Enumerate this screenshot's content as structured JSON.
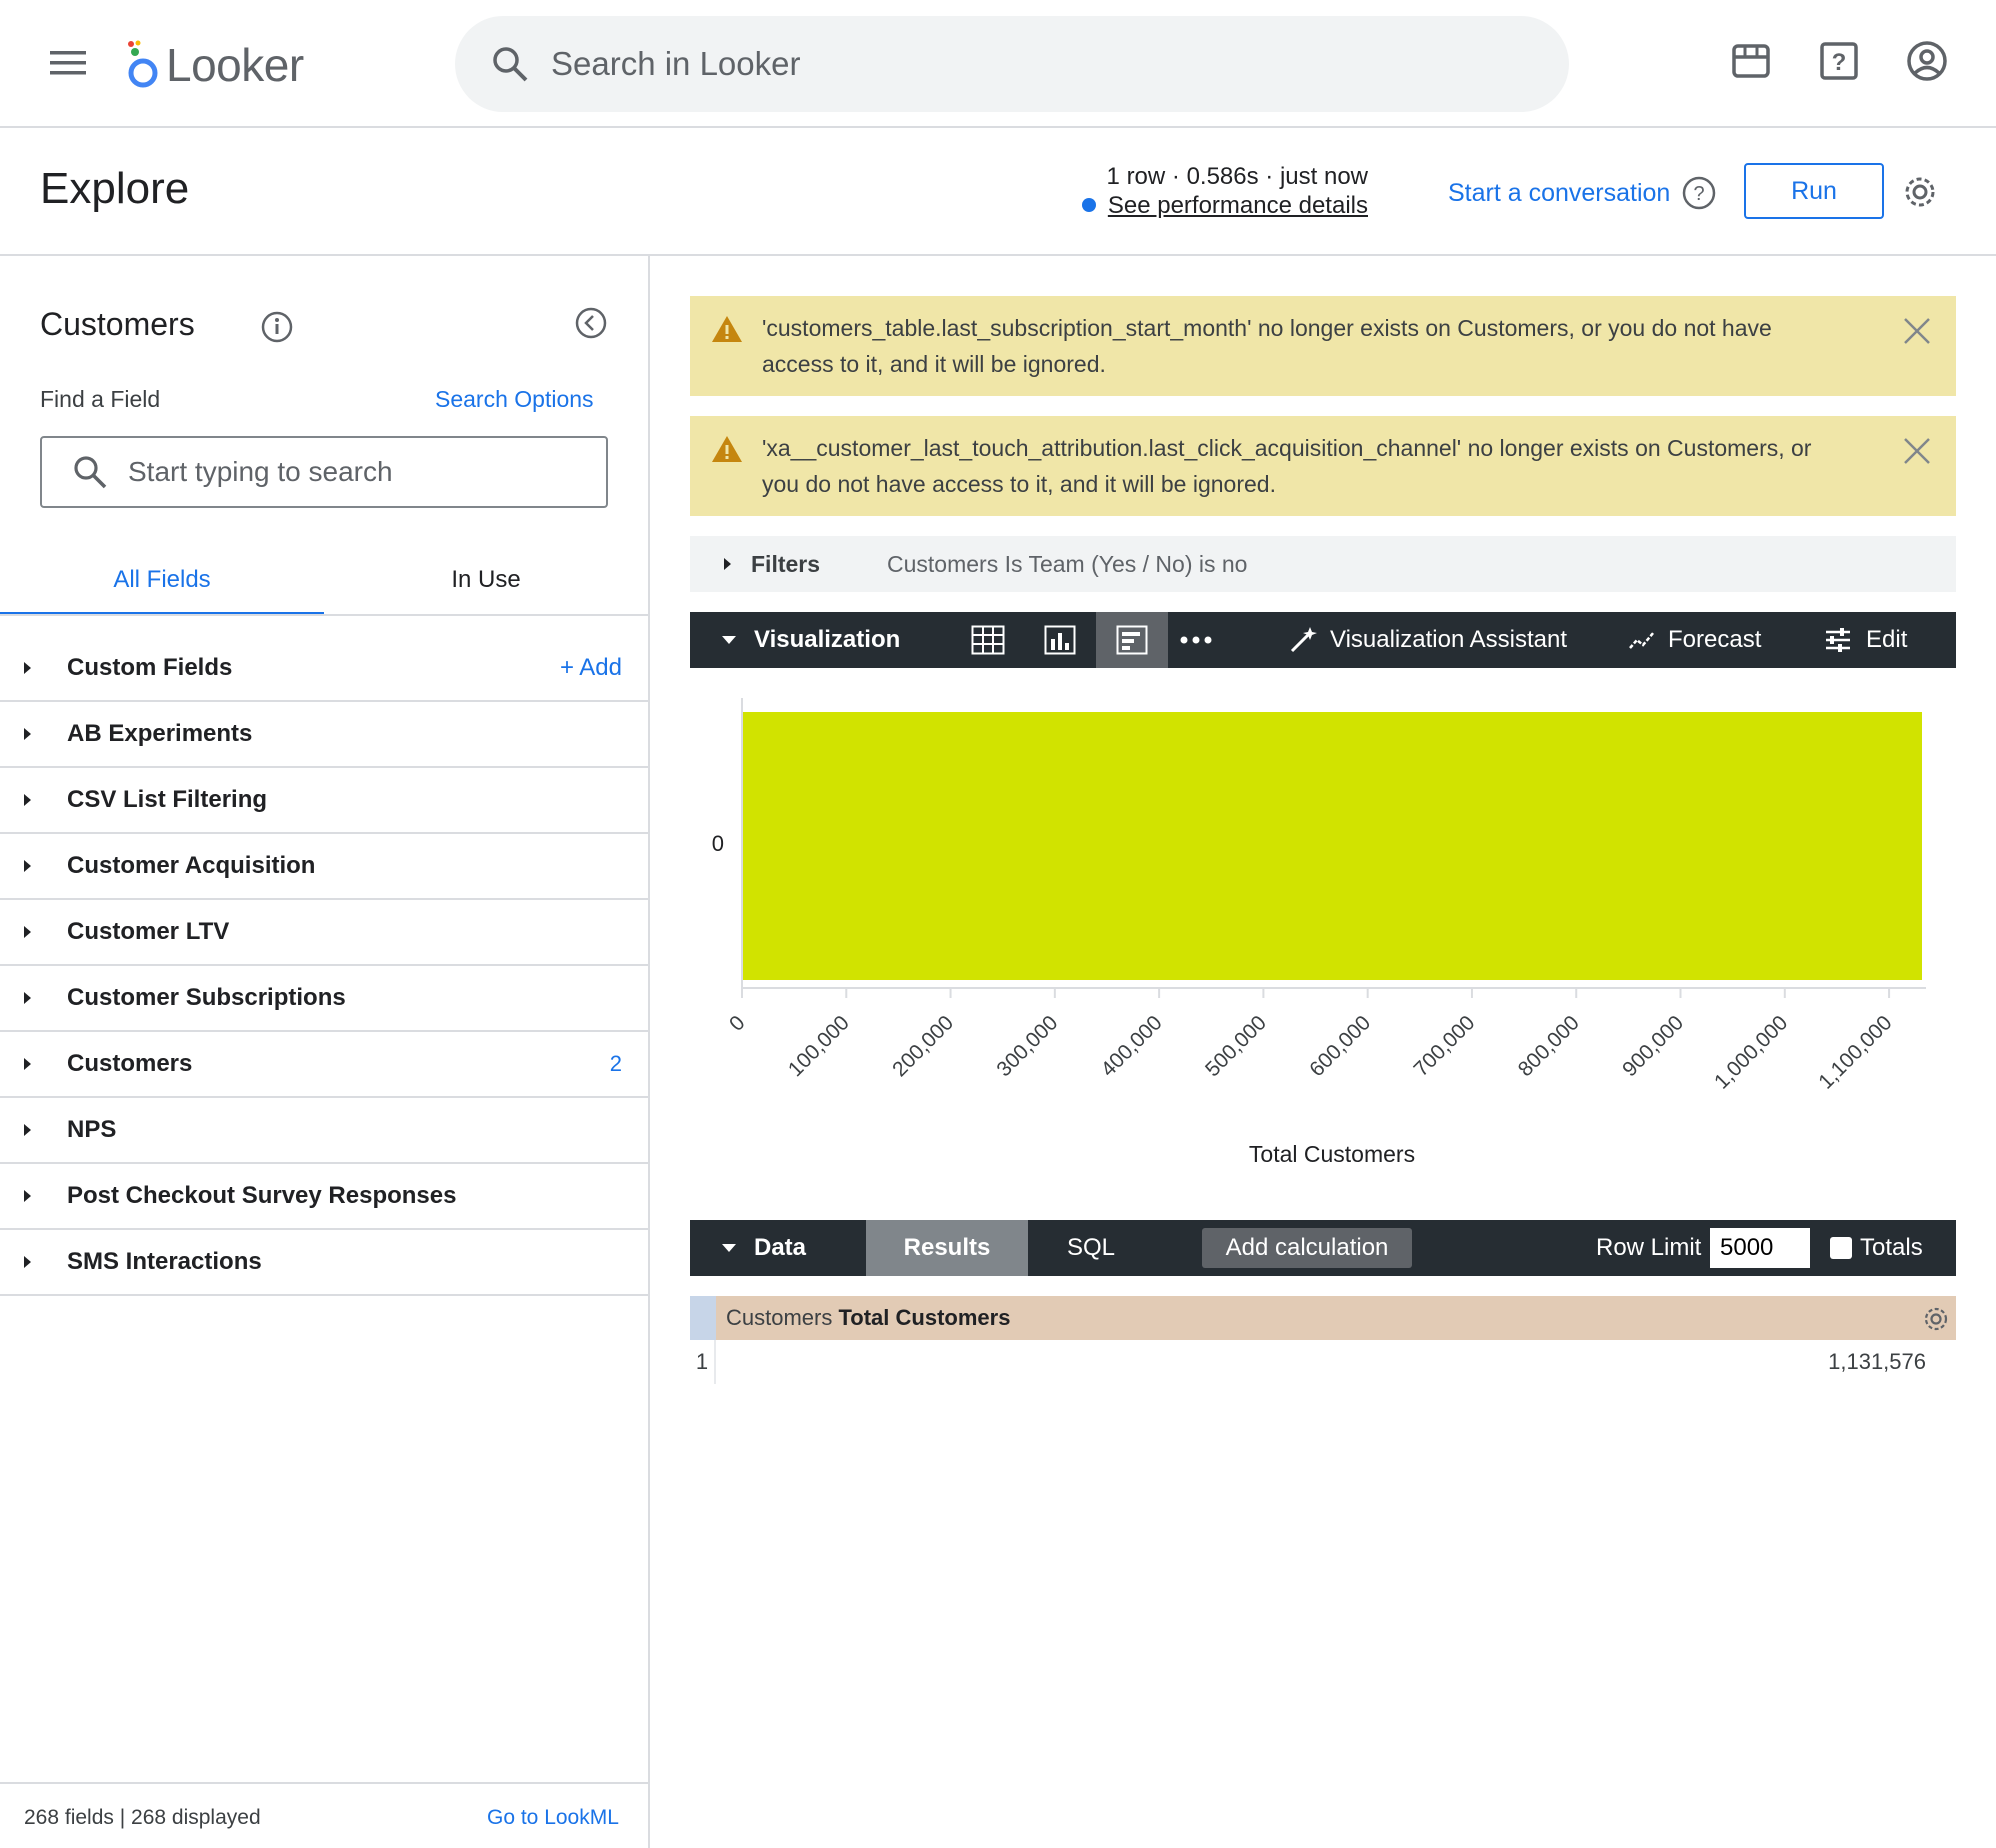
{
  "app": {
    "name": "Looker"
  },
  "topbar": {
    "search_placeholder": "Search in Looker",
    "icons": [
      "menu-icon",
      "marketplace-icon",
      "help-icon",
      "account-icon"
    ]
  },
  "header": {
    "title": "Explore",
    "stats": "1 row · 0.586s · just now",
    "perf_link": "See performance details",
    "conversation": "Start a conversation",
    "run_label": "Run"
  },
  "sidebar": {
    "title": "Customers",
    "find_label": "Find a Field",
    "search_options": "Search Options",
    "search_placeholder": "Start typing to search",
    "tabs": {
      "all": "All Fields",
      "in_use": "In Use"
    },
    "groups": [
      {
        "label": "Custom Fields",
        "action": "+ Add"
      },
      {
        "label": "AB Experiments"
      },
      {
        "label": "CSV List Filtering"
      },
      {
        "label": "Customer Acquisition"
      },
      {
        "label": "Customer LTV"
      },
      {
        "label": "Customer Subscriptions"
      },
      {
        "label": "Customers",
        "count": "2"
      },
      {
        "label": "NPS"
      },
      {
        "label": "Post Checkout Survey Responses"
      },
      {
        "label": "SMS Interactions"
      }
    ],
    "footer_count": "268 fields | 268 displayed",
    "footer_link": "Go to LookML"
  },
  "warnings": [
    "'customers_table.last_subscription_start_month' no longer exists on Customers, or you do not have access to it, and it will be ignored.",
    "'xa__customer_last_touch_attribution.last_click_acquisition_channel' no longer exists on Customers, or you do not have access to it, and it will be ignored."
  ],
  "filters": {
    "label": "Filters",
    "text": "Customers Is Team (Yes / No) is no"
  },
  "visualization": {
    "label": "Visualization",
    "assistant": "Visualization Assistant",
    "forecast": "Forecast",
    "edit": "Edit"
  },
  "chart_data": {
    "type": "bar",
    "orientation": "horizontal",
    "categories": [
      "0"
    ],
    "values": [
      1131576
    ],
    "xlabel": "Total Customers",
    "xlim": [
      0,
      1131576
    ],
    "ticks": [
      "0",
      "100,000",
      "200,000",
      "300,000",
      "400,000",
      "500,000",
      "600,000",
      "700,000",
      "800,000",
      "900,000",
      "1,000,000",
      "1,100,000"
    ],
    "bar_color": "#d1e300"
  },
  "data_panel": {
    "label": "Data",
    "results_tab": "Results",
    "sql_tab": "SQL",
    "add_calculation": "Add calculation",
    "row_limit_label": "Row Limit",
    "row_limit_value": "5000",
    "totals_label": "Totals"
  },
  "table": {
    "header_view": "Customers",
    "header_field": "Total Customers",
    "rows": [
      {
        "num": "1",
        "value": "1,131,576"
      }
    ]
  }
}
